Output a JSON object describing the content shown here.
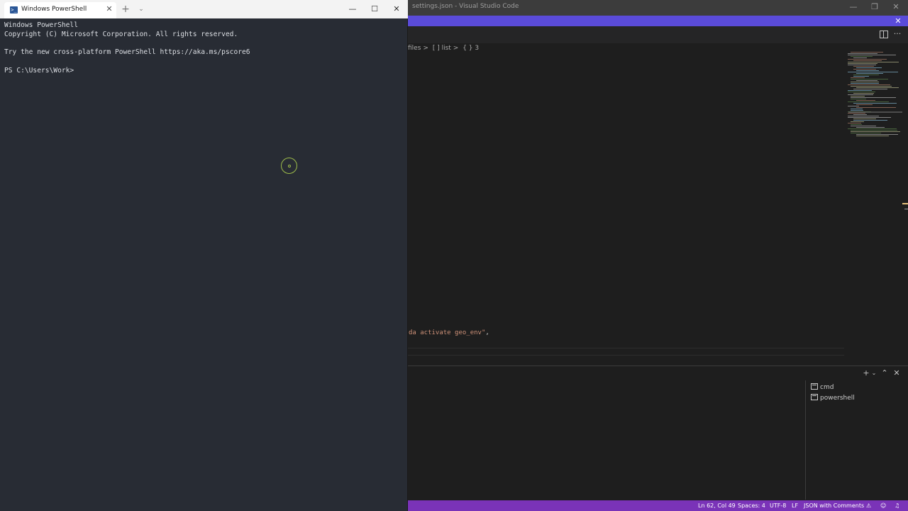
{
  "vscode": {
    "title": "settings.json - Visual Studio Code",
    "notification_close": "✕",
    "window_controls": {
      "minimize": "—",
      "restore": "❐",
      "close": "✕"
    },
    "editor_actions": {
      "split_icon": "split-editor-icon",
      "more": "···"
    },
    "breadcrumb": [
      "files",
      "[ ] list",
      "{ } 3"
    ],
    "breadcrumb_sep": ">",
    "code_line": {
      "text": "da activate geo_env\"",
      "trailing": ","
    },
    "panel": {
      "actions": {
        "add": "+",
        "dropdown": "⌄",
        "maximize": "⌃",
        "close": "✕"
      },
      "terminals": [
        "cmd",
        "powershell"
      ]
    },
    "statusbar": {
      "position": "Ln 62, Col 49",
      "spaces": "Spaces: 4",
      "encoding": "UTF-8",
      "eol": "LF",
      "language": "JSON with Comments",
      "warn_icon": "⚠",
      "feedback_icon": "☺",
      "bell_icon": "🔔"
    },
    "colors": {
      "notification": "#5a4bd9",
      "statusbar": "#7a33b8",
      "string": "#ce9178"
    }
  },
  "terminal": {
    "tab_label": "Windows PowerShell",
    "tab_icon": "powershell-icon",
    "tab_close": "✕",
    "new_tab": "+",
    "dropdown": "⌄",
    "window_controls": {
      "minimize": "—",
      "maximize": "☐",
      "close": "✕"
    },
    "lines": [
      "Windows PowerShell",
      "Copyright (C) Microsoft Corporation. All rights reserved.",
      "",
      "Try the new cross-platform PowerShell https://aka.ms/pscore6",
      "",
      "PS C:\\Users\\Work>"
    ],
    "colors": {
      "background": "#282c34",
      "foreground": "#dcdfe4"
    }
  }
}
